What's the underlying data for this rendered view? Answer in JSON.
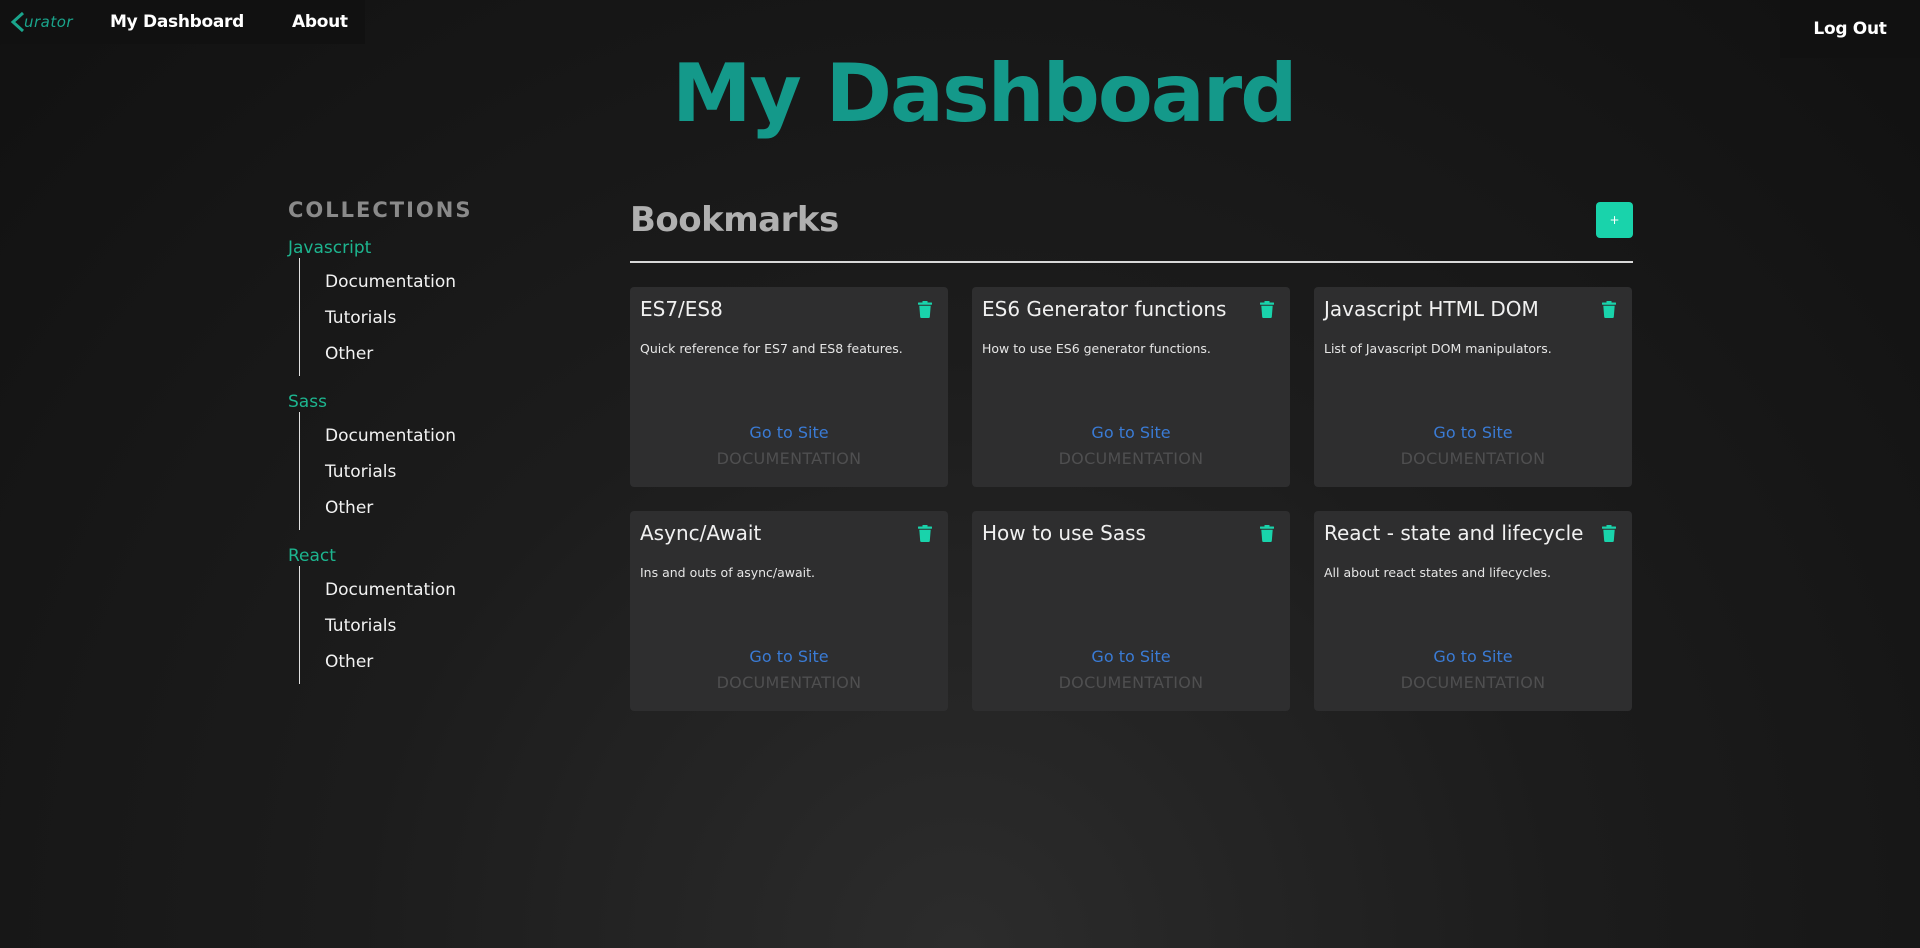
{
  "nav": {
    "logo_text": "urator",
    "links": [
      "My Dashboard",
      "About"
    ],
    "logout": "Log Out"
  },
  "page_title": "My Dashboard",
  "sidebar": {
    "heading": "COLLECTIONS",
    "collections": [
      {
        "name": "Javascript",
        "items": [
          "Documentation",
          "Tutorials",
          "Other"
        ]
      },
      {
        "name": "Sass",
        "items": [
          "Documentation",
          "Tutorials",
          "Other"
        ]
      },
      {
        "name": "React",
        "items": [
          "Documentation",
          "Tutorials",
          "Other"
        ]
      }
    ]
  },
  "bookmarks": {
    "title": "Bookmarks",
    "add_label": "+",
    "cards": [
      {
        "title": "ES7/ES8",
        "description": "Quick reference for ES7 and ES8 features.",
        "link": "Go to Site",
        "tag": "DOCUMENTATION"
      },
      {
        "title": "ES6 Generator functions",
        "description": "How to use ES6 generator functions.",
        "link": "Go to Site",
        "tag": "DOCUMENTATION"
      },
      {
        "title": "Javascript HTML DOM",
        "description": "List of Javascript DOM manipulators.",
        "link": "Go to Site",
        "tag": "DOCUMENTATION"
      },
      {
        "title": "Async/Await",
        "description": "Ins and outs of async/await.",
        "link": "Go to Site",
        "tag": "DOCUMENTATION"
      },
      {
        "title": "How to use Sass",
        "description": "",
        "link": "Go to Site",
        "tag": "DOCUMENTATION"
      },
      {
        "title": "React - state and lifecycle",
        "description": "All about react states and lifecycles.",
        "link": "Go to Site",
        "tag": "DOCUMENTATION"
      }
    ]
  },
  "colors": {
    "accent": "#19d3ab",
    "title": "#14998a",
    "link": "#3a7bd5",
    "card_bg": "#2e2e2f"
  },
  "icons": {
    "logo": "chevron-left-icon",
    "delete": "trash-icon"
  }
}
